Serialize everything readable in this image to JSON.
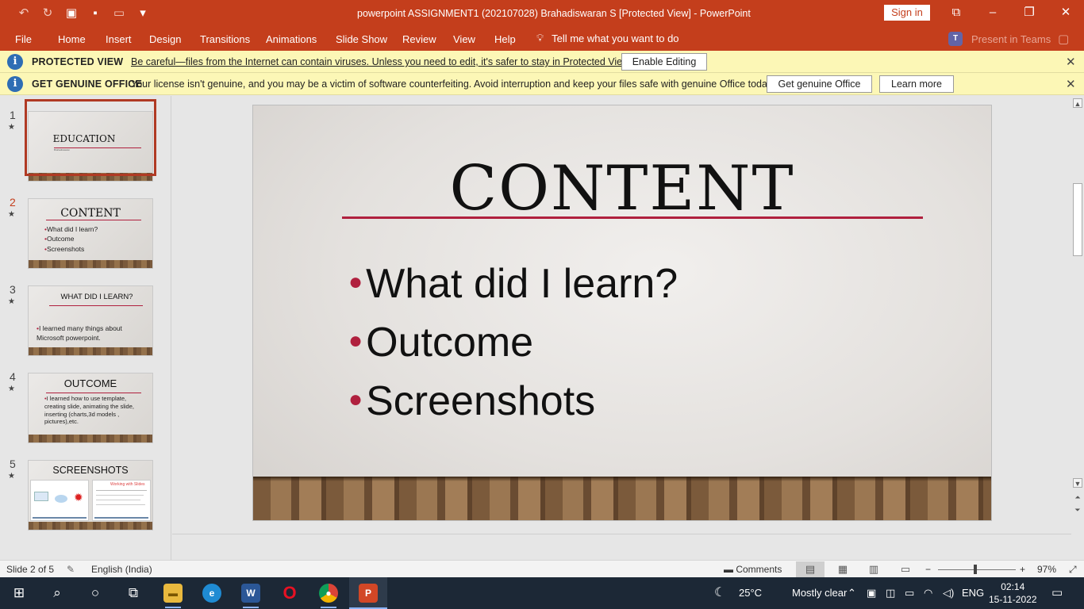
{
  "window": {
    "title": "powerpoint ASSIGNMENT1 (202107028) Brahadiswaran S [Protected View]  -  PowerPoint",
    "sign_in": "Sign in"
  },
  "ribbon": {
    "tabs": [
      "File",
      "Home",
      "Insert",
      "Design",
      "Transitions",
      "Animations",
      "Slide Show",
      "Review",
      "View",
      "Help"
    ],
    "tell_me": "Tell me what you want to do",
    "present_in_teams": "Present in Teams"
  },
  "protected_view": {
    "label": "PROTECTED VIEW",
    "message": "Be careful—files from the Internet can contain viruses. Unless you need to edit, it's safer to stay in Protected View.",
    "enable_button": "Enable Editing"
  },
  "genuine_office": {
    "label": "GET GENUINE OFFICE",
    "message": "Your license isn't genuine, and you may be a victim of software counterfeiting. Avoid interruption and keep your files safe with genuine Office today.",
    "get_button": "Get genuine Office",
    "learn_button": "Learn more"
  },
  "thumbnails": [
    {
      "number": "1",
      "title": "EDUCATION",
      "subtitle": "Brahadiswaran"
    },
    {
      "number": "2",
      "title": "CONTENT",
      "bullets": [
        "What did I learn?",
        "Outcome",
        "Screenshots"
      ]
    },
    {
      "number": "3",
      "title": "WHAT DID I LEARN?",
      "bullets": [
        "I learned many things about Microsoft powerpoint."
      ]
    },
    {
      "number": "4",
      "title": "OUTCOME",
      "bullets": [
        "I learned how to use template, creating slide, animating the slide, inserting (charts,3d models , pictures),etc."
      ]
    },
    {
      "number": "5",
      "title": "SCREENSHOTS",
      "caption": "Working with Slides"
    }
  ],
  "selected_slide": 2,
  "slide": {
    "title": "CONTENT",
    "bullets": [
      "What did I learn?",
      "Outcome",
      "Screenshots"
    ]
  },
  "status": {
    "slide_indicator": "Slide 2 of 5",
    "language": "English (India)",
    "comments": "Comments",
    "zoom": "97%"
  },
  "taskbar": {
    "weather_temp": "25°C",
    "weather_text": "Mostly clear",
    "language": "ENG",
    "time": "02:14",
    "date": "15-11-2022"
  },
  "colors": {
    "accent": "#c43e1c",
    "title_rule": "#b0203e",
    "message_bar": "#fcf7b6",
    "taskbar": "#1c2836"
  }
}
